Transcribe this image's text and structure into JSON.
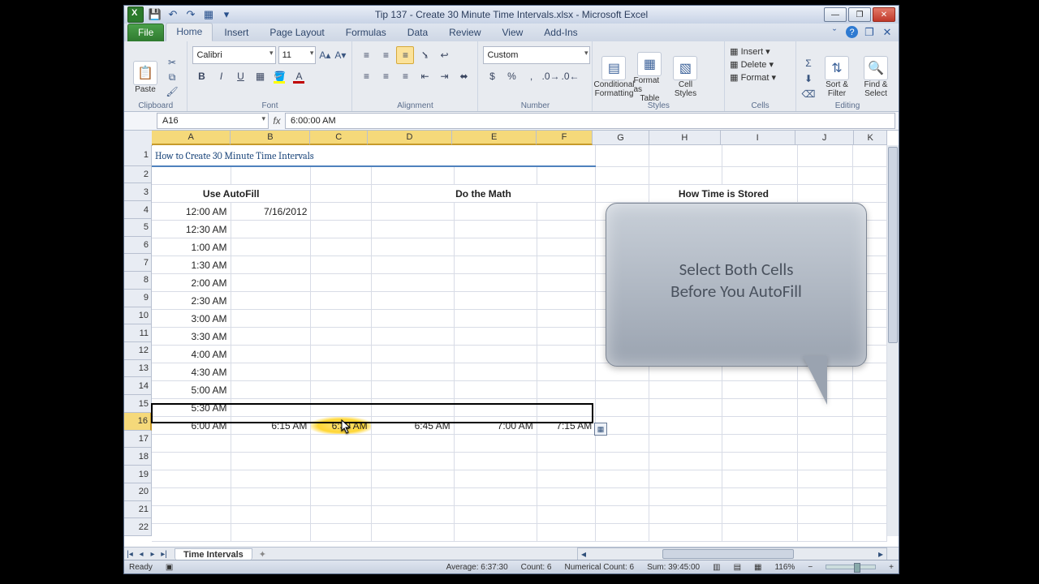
{
  "window": {
    "title": "Tip 137 - Create 30 Minute Time Intervals.xlsx - Microsoft Excel"
  },
  "tabs": {
    "file": "File",
    "home": "Home",
    "insert": "Insert",
    "pagelayout": "Page Layout",
    "formulas": "Formulas",
    "data": "Data",
    "review": "Review",
    "view": "View",
    "addins": "Add-Ins"
  },
  "ribbon": {
    "clipboard": "Clipboard",
    "paste": "Paste",
    "font_group": "Font",
    "font_name": "Calibri",
    "font_size": "11",
    "alignment": "Alignment",
    "number": "Number",
    "number_format": "Custom",
    "styles": "Styles",
    "cond": "Conditional",
    "cond2": "Formatting",
    "fat": "Format as",
    "fat2": "Table",
    "cellstyles": "Cell",
    "cellstyles2": "Styles",
    "cells_group": "Cells",
    "insert": "Insert",
    "delete": "Delete",
    "format": "Format",
    "editing": "Editing",
    "sort": "Sort &",
    "sort2": "Filter",
    "find": "Find &",
    "find2": "Select"
  },
  "fbar": {
    "name": "A16",
    "formula": "6:00:00 AM"
  },
  "columns": [
    "A",
    "B",
    "C",
    "D",
    "E",
    "F",
    "G",
    "H",
    "I",
    "J",
    "K"
  ],
  "rows": [
    "1",
    "2",
    "3",
    "4",
    "5",
    "6",
    "7",
    "8",
    "9",
    "10",
    "11",
    "12",
    "13",
    "14",
    "15",
    "16",
    "17",
    "18",
    "19",
    "20",
    "21",
    "22"
  ],
  "selected_row_index": 15,
  "sheet": {
    "title_row": "How to Create 30 Minute Time Intervals",
    "hdr_autofill": "Use AutoFill",
    "hdr_math": "Do the Math",
    "hdr_stored": "How Time is Stored",
    "colA": [
      "12:00 AM",
      "12:30 AM",
      "1:00 AM",
      "1:30 AM",
      "2:00 AM",
      "2:30 AM",
      "3:00 AM",
      "3:30 AM",
      "4:00 AM",
      "4:30 AM",
      "5:00 AM",
      "5:30 AM",
      "6:00 AM"
    ],
    "b4": "7/16/2012",
    "row16": [
      "6:00 AM",
      "6:15 AM",
      "6:30 AM",
      "6:45 AM",
      "7:00 AM",
      "7:15 AM"
    ]
  },
  "callout": {
    "line1": "Select Both Cells",
    "line2": "Before You AutoFill"
  },
  "sheettab": "Time Intervals",
  "status": {
    "ready": "Ready",
    "avg": "Average: 6:37:30",
    "count": "Count: 6",
    "ncount": "Numerical Count: 6",
    "sum": "Sum: 39:45:00",
    "zoom": "116%"
  }
}
